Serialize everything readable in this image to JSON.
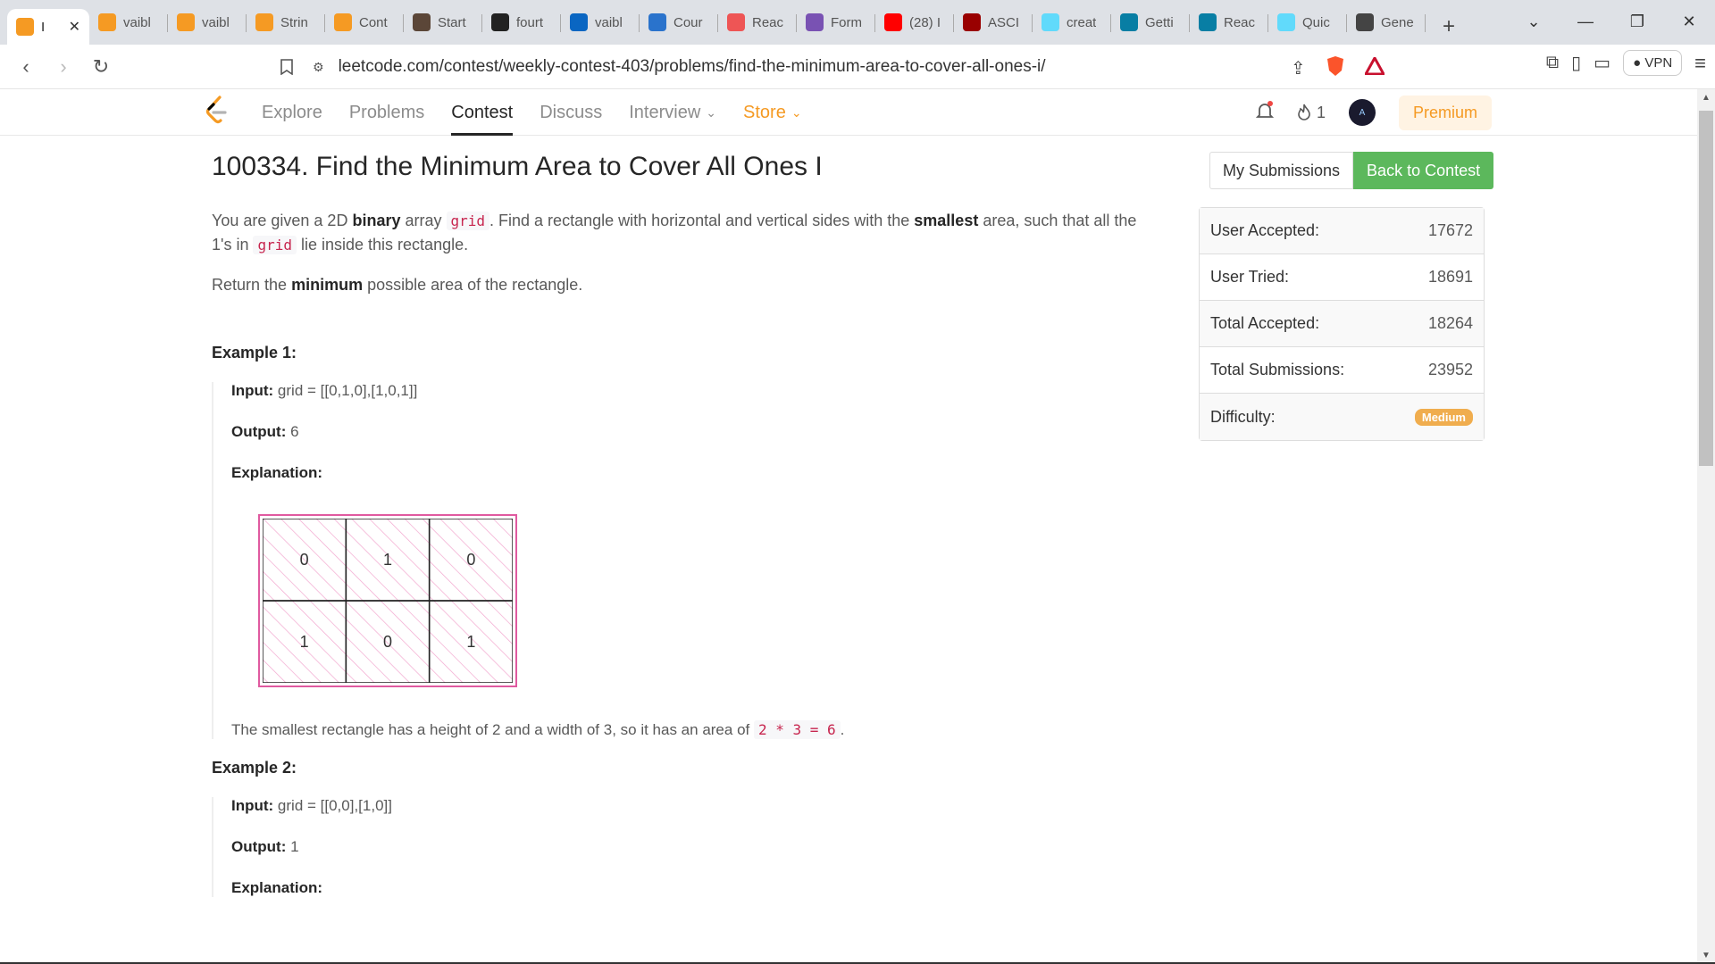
{
  "browser": {
    "tabs": [
      {
        "label": "I",
        "icon": "leetcode-icon",
        "color": "#f59a23",
        "active": true
      },
      {
        "label": "vaibl",
        "icon": "leetcode-icon",
        "color": "#f59a23"
      },
      {
        "label": "vaibl",
        "icon": "leetcode-icon",
        "color": "#f59a23"
      },
      {
        "label": "Strin",
        "icon": "leetcode-icon",
        "color": "#f59a23"
      },
      {
        "label": "Cont",
        "icon": "leetcode-icon",
        "color": "#f59a23"
      },
      {
        "label": "Start",
        "icon": "codechef-icon",
        "color": "#5b4638"
      },
      {
        "label": "fourt",
        "icon": "github-icon",
        "color": "#222"
      },
      {
        "label": "vaibl",
        "icon": "linkedin-icon",
        "color": "#0a66c2"
      },
      {
        "label": "Cour",
        "icon": "coursera-icon",
        "color": "#2a73cc"
      },
      {
        "label": "Reac",
        "icon": "rainbow-icon",
        "color": "#e55"
      },
      {
        "label": "Form",
        "icon": "bootstrap-icon",
        "color": "#7952b3"
      },
      {
        "label": "(28) I",
        "icon": "youtube-icon",
        "color": "#f00"
      },
      {
        "label": "ASCI",
        "icon": "ascii-icon",
        "color": "#900"
      },
      {
        "label": "creat",
        "icon": "react-icon",
        "color": "#61dafb"
      },
      {
        "label": "Getti",
        "icon": "react-icon",
        "color": "#087ea4"
      },
      {
        "label": "Reac",
        "icon": "react-icon",
        "color": "#087ea4"
      },
      {
        "label": "Quic",
        "icon": "react-icon",
        "color": "#61dafb"
      },
      {
        "label": "Gene",
        "icon": "openai-icon",
        "color": "#444"
      }
    ],
    "url": "leetcode.com/contest/weekly-contest-403/problems/find-the-minimum-area-to-cover-all-ones-i/",
    "vpn_label": "VPN"
  },
  "nav": {
    "links": [
      "Explore",
      "Problems",
      "Contest",
      "Discuss",
      "Interview",
      "Store"
    ],
    "streak": "1",
    "premium": "Premium"
  },
  "problem": {
    "title": "100334. Find the Minimum Area to Cover All Ones I",
    "p1_a": "You are given a 2D ",
    "p1_b": "binary",
    "p1_c": " array ",
    "p1_code": "grid",
    "p1_d": ". Find a rectangle with horizontal and vertical sides with the ",
    "p1_e": "smallest",
    "p1_f": " area, such that all the 1's in ",
    "p1_code2": "grid",
    "p1_g": " lie inside this rectangle.",
    "p2_a": "Return the ",
    "p2_b": "minimum",
    "p2_c": " possible area of the rectangle.",
    "examples": [
      {
        "heading": "Example 1:",
        "input_label": "Input:",
        "input": " grid = [[0,1,0],[1,0,1]]",
        "output_label": "Output:",
        "output": " 6",
        "explanation_label": "Explanation:",
        "grid": [
          [
            0,
            1,
            0
          ],
          [
            1,
            0,
            1
          ]
        ],
        "note": "The smallest rectangle has a height of 2 and a width of 3, so it has an area of ",
        "note_code": "2 * 3 = 6",
        "note_end": "."
      },
      {
        "heading": "Example 2:",
        "input_label": "Input:",
        "input": " grid = [[0,0],[1,0]]",
        "output_label": "Output:",
        "output": " 1",
        "explanation_label": "Explanation:"
      }
    ]
  },
  "side": {
    "my_submissions": "My Submissions",
    "back_to_contest": "Back to Contest",
    "stats": [
      {
        "k": "User Accepted:",
        "v": "17672"
      },
      {
        "k": "User Tried:",
        "v": "18691"
      },
      {
        "k": "Total Accepted:",
        "v": "18264"
      },
      {
        "k": "Total Submissions:",
        "v": "23952"
      }
    ],
    "difficulty_label": "Difficulty:",
    "difficulty": "Medium"
  }
}
